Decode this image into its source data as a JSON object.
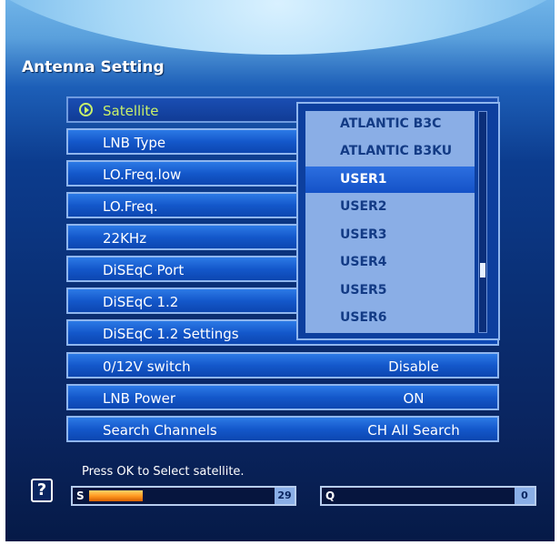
{
  "title": "Antenna Setting",
  "menu": [
    {
      "label": "Satellite",
      "value": "",
      "selected": true
    },
    {
      "label": "LNB Type",
      "value": ""
    },
    {
      "label": "LO.Freq.low",
      "value": ""
    },
    {
      "label": "LO.Freq.",
      "value": ""
    },
    {
      "label": "22KHz",
      "value": ""
    },
    {
      "label": "DiSEqC Port",
      "value": ""
    },
    {
      "label": "DiSEqC 1.2",
      "value": ""
    },
    {
      "label": "DiSEqC 1.2 Settings",
      "value": ""
    },
    {
      "label": "0/12V switch",
      "value": "Disable"
    },
    {
      "label": "LNB Power",
      "value": "ON"
    },
    {
      "label": "Search Channels",
      "value": "CH All Search"
    }
  ],
  "dropdown": {
    "options": [
      "ATLANTIC B3C",
      "ATLANTIC B3KU",
      "USER1",
      "USER2",
      "USER3",
      "USER4",
      "USER5",
      "USER6"
    ],
    "highlighted_index": 2
  },
  "hint": "Press OK to Select satellite.",
  "help_icon": "question-icon",
  "signal": {
    "letter": "S",
    "value": "29",
    "level": 0.29
  },
  "quality": {
    "letter": "Q",
    "value": "0",
    "level": 0.0
  }
}
